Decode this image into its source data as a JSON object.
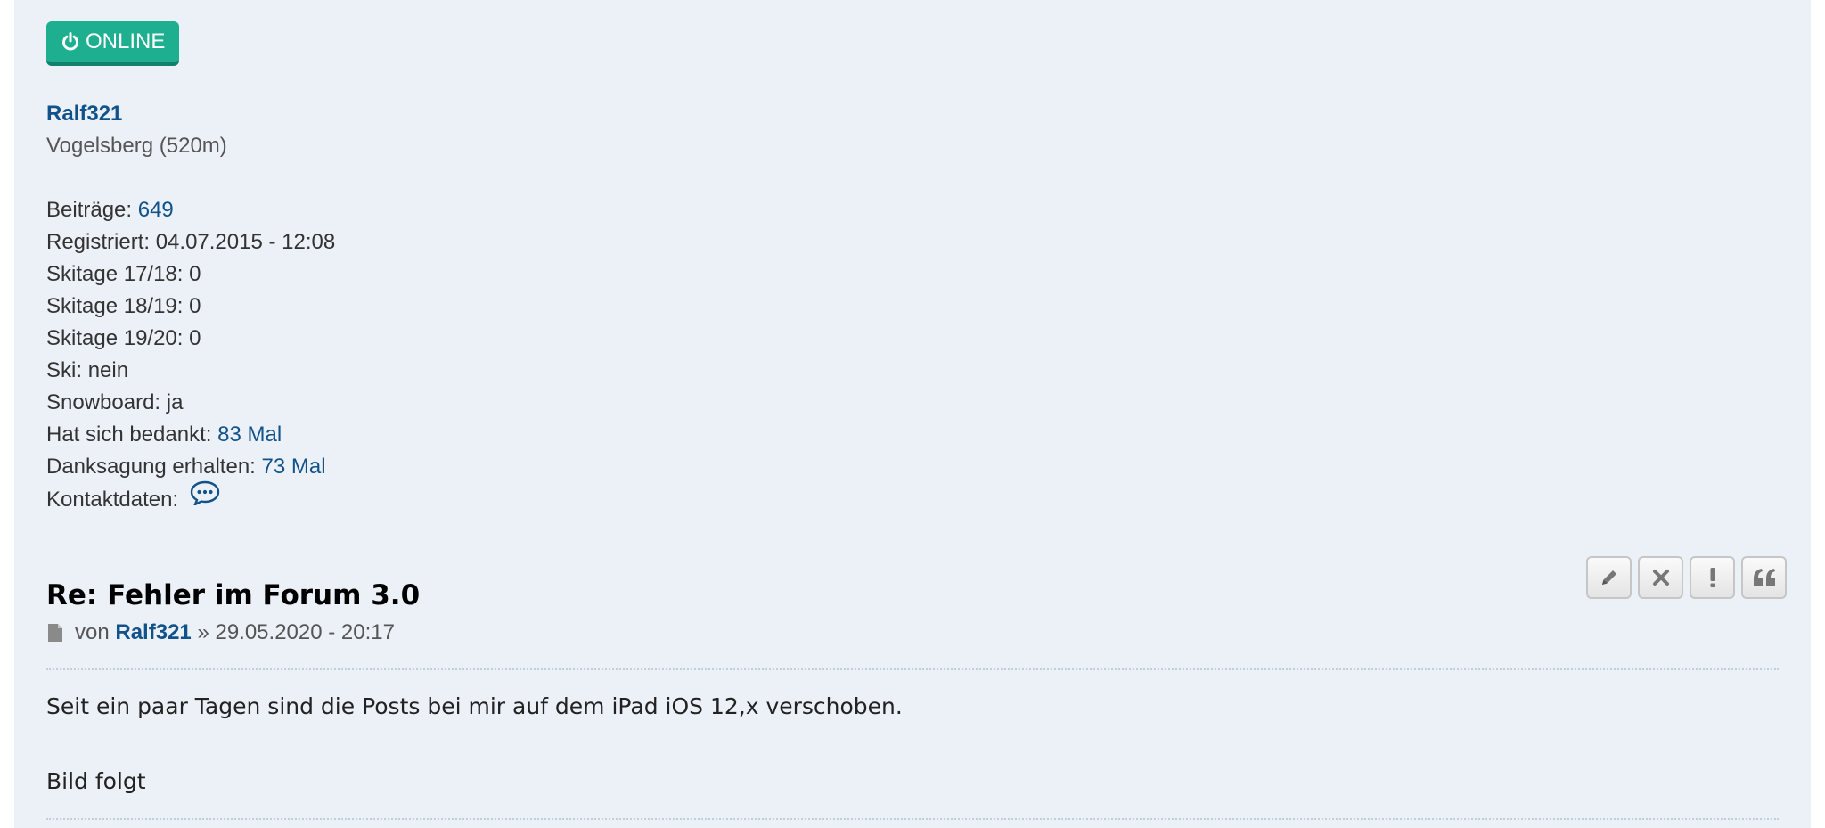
{
  "status": {
    "label": "ONLINE",
    "color": "#1DAF8F"
  },
  "profile": {
    "username": "Ralf321",
    "location": "Vogelsberg (520m)",
    "posts_label": "Beiträge:",
    "posts_value": "649",
    "registered_label": "Registriert:",
    "registered_value": "04.07.2015 - 12:08",
    "skitage_1718_label": "Skitage 17/18:",
    "skitage_1718_value": "0",
    "skitage_1819_label": "Skitage 18/19:",
    "skitage_1819_value": "0",
    "skitage_1920_label": "Skitage 19/20:",
    "skitage_1920_value": "0",
    "ski_label": "Ski:",
    "ski_value": "nein",
    "snowboard_label": "Snowboard:",
    "snowboard_value": "ja",
    "thanked_label": "Hat sich bedankt:",
    "thanked_value": "83 Mal",
    "thanks_received_label": "Danksagung erhalten:",
    "thanks_received_value": "73 Mal",
    "contact_label": "Kontaktdaten:",
    "contact_icon": "chat-bubble-icon"
  },
  "post": {
    "title": "Re: Fehler im Forum 3.0",
    "meta_prefix": "von",
    "author": "Ralf321",
    "separator": "»",
    "datetime": "29.05.2020 - 20:17",
    "body_line1": "Seit ein paar Tagen sind die Posts bei mir auf dem iPad iOS 12,x verschoben.",
    "body_line2": "Bild folgt",
    "actions": [
      "pencil-icon",
      "close-icon",
      "exclamation-icon",
      "quote-icon"
    ]
  },
  "colors": {
    "panel_bg": "#ECF1F8",
    "link": "#105289"
  }
}
